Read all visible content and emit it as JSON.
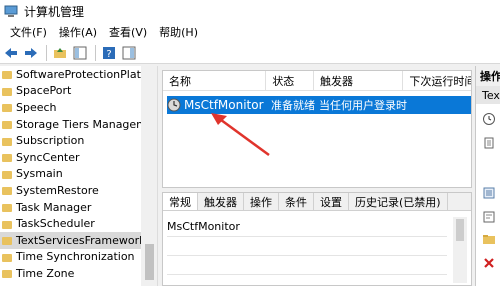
{
  "window": {
    "title": "计算机管理"
  },
  "menu": [
    "文件(F)",
    "操作(A)",
    "查看(V)",
    "帮助(H)"
  ],
  "tree": {
    "items": [
      {
        "label": "SoftwareProtectionPlatform",
        "selected": false
      },
      {
        "label": "SpacePort",
        "selected": false
      },
      {
        "label": "Speech",
        "selected": false
      },
      {
        "label": "Storage Tiers Management",
        "selected": false
      },
      {
        "label": "Subscription",
        "selected": false
      },
      {
        "label": "SyncCenter",
        "selected": false
      },
      {
        "label": "Sysmain",
        "selected": false
      },
      {
        "label": "SystemRestore",
        "selected": false
      },
      {
        "label": "Task Manager",
        "selected": false
      },
      {
        "label": "TaskScheduler",
        "selected": false
      },
      {
        "label": "TextServicesFramework",
        "selected": true
      },
      {
        "label": "Time Synchronization",
        "selected": false
      },
      {
        "label": "Time Zone",
        "selected": false
      }
    ]
  },
  "task_list": {
    "columns": [
      "名称",
      "状态",
      "触发器",
      "下次运行时间"
    ],
    "rows": [
      {
        "name": "MsCtfMonitor",
        "status": "准备就绪",
        "trigger": "当任何用户登录时",
        "next_run": ""
      }
    ]
  },
  "details": {
    "tabs": [
      "常规",
      "触发器",
      "操作",
      "条件",
      "设置",
      "历史记录(已禁用)"
    ],
    "active_tab": 0,
    "name_value": "MsCtfMonitor"
  },
  "actions_pane": {
    "title": "操作",
    "subtitle": "TextServicesFramework"
  },
  "colors": {
    "selection": "#0a78d7",
    "folder": "#e9c25e",
    "arrow": "#e0342c"
  }
}
